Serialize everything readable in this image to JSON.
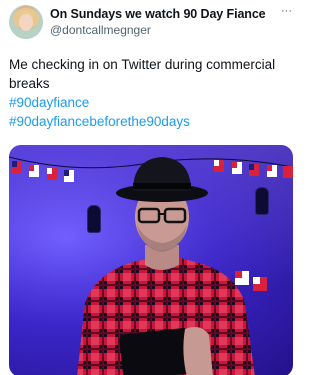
{
  "tweet": {
    "display_name": "On Sundays we watch 90 Day Fiance",
    "handle": "@dontcallmegnger",
    "more_label": "···",
    "text": "Me checking in on Twitter during commercial breaks",
    "hashtags": [
      "#90dayfiance",
      "#90dayfiancebeforethe90days"
    ]
  },
  "colors": {
    "link": "#1d9bf0",
    "secondary_text": "#536471",
    "primary_text": "#0f1419"
  },
  "icons": {
    "more": "more-horizontal-icon"
  }
}
